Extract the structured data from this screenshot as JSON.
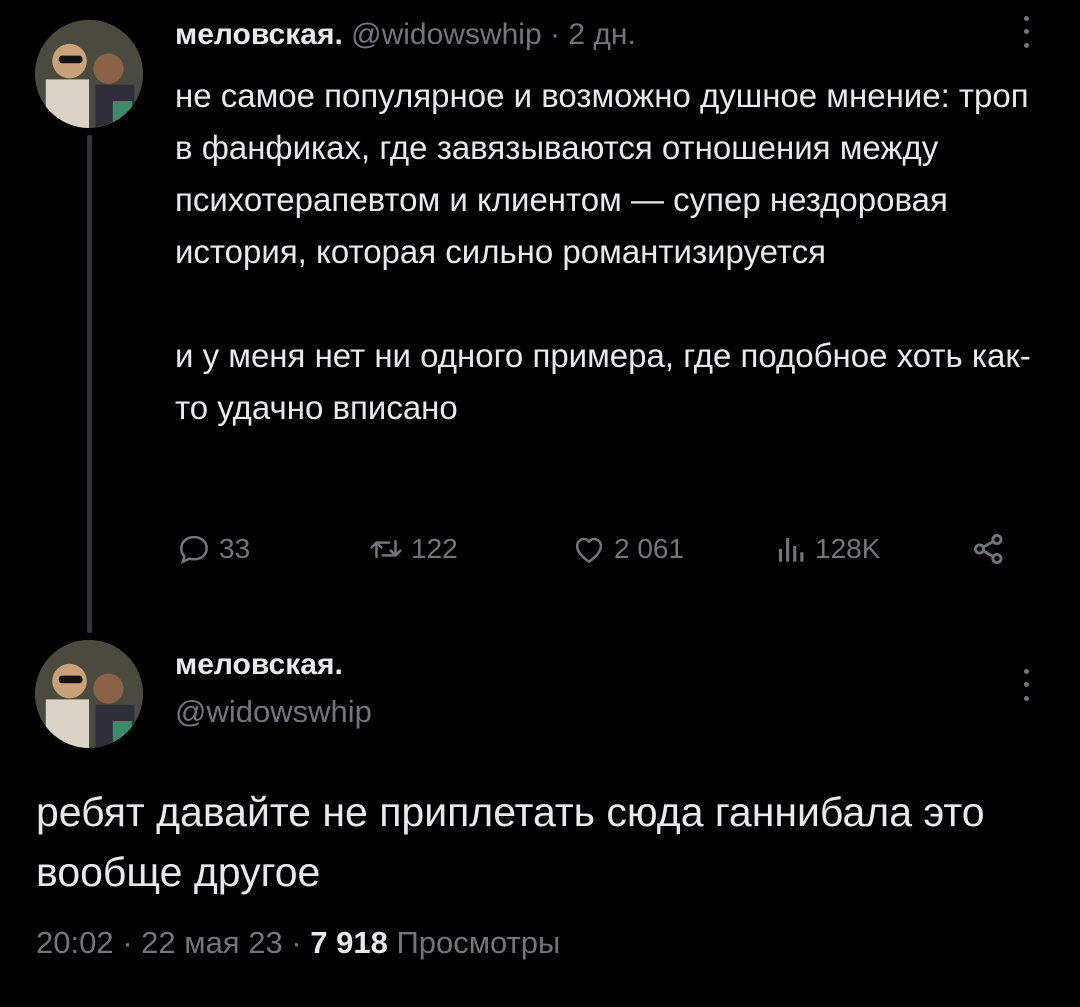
{
  "reply_tweet": {
    "author_name": "меловская.",
    "author_handle": "@widowswhip",
    "separator": "·",
    "time_ago": "2 дн.",
    "paragraph1": "не самое популярное и возможно душное мнение: троп в фанфиках, где завязываются отношения между психотерапевтом и клиентом — супер нездоровая история, которая сильно романтизируется",
    "paragraph2": "и у меня нет ни одного примера, где подобное хоть как-то удачно вписано",
    "actions": {
      "replies": "33",
      "retweets": "122",
      "likes": "2 061",
      "views": "128K"
    }
  },
  "main_tweet": {
    "author_name": "меловская.",
    "author_handle": "@widowswhip",
    "text": "ребят давайте не приплетать сюда ганнибала это вообще другое",
    "time": "20:02",
    "separator": "·",
    "date": "22 мая 23",
    "views_count": "7 918",
    "views_label": "Просмотры"
  },
  "icons": {
    "reply": "reply-icon",
    "retweet": "retweet-icon",
    "like": "heart-icon",
    "views": "views-icon",
    "share": "share-icon",
    "more": "more-vertical-icon"
  },
  "colors": {
    "background": "#000000",
    "text": "#e7e9ea",
    "muted": "#71767b",
    "thread_line": "#333639"
  }
}
